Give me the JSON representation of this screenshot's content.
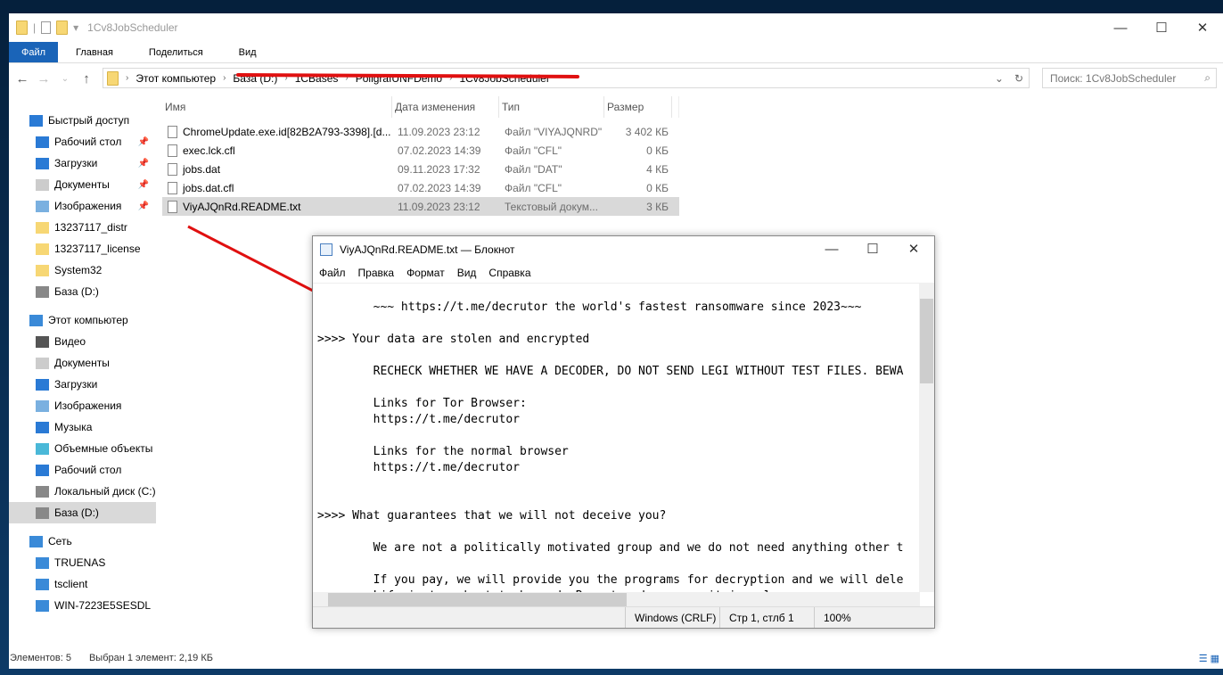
{
  "explorer": {
    "title": "1Cv8JobScheduler",
    "ribbon_tabs": [
      "Файл",
      "Главная",
      "Поделиться",
      "Вид"
    ],
    "breadcrumb": [
      "Этот компьютер",
      "База (D:)",
      "1CBases",
      "PoligrafUNFDemo",
      "1Cv8JobScheduler"
    ],
    "search_placeholder": "Поиск: 1Cv8JobScheduler",
    "columns": [
      "Имя",
      "Дата изменения",
      "Тип",
      "Размер"
    ],
    "files": [
      {
        "name": "ChromeUpdate.exe.id[82B2A793-3398].[d...",
        "date": "11.09.2023 23:12",
        "type": "Файл \"VIYAJQNRD\"",
        "size": "3 402 КБ"
      },
      {
        "name": "exec.lck.cfl",
        "date": "07.02.2023 14:39",
        "type": "Файл \"CFL\"",
        "size": "0 КБ"
      },
      {
        "name": "jobs.dat",
        "date": "09.11.2023 17:32",
        "type": "Файл \"DAT\"",
        "size": "4 КБ"
      },
      {
        "name": "jobs.dat.cfl",
        "date": "07.02.2023 14:39",
        "type": "Файл \"CFL\"",
        "size": "0 КБ"
      },
      {
        "name": "ViyAJQnRd.README.txt",
        "date": "11.09.2023 23:12",
        "type": "Текстовый докум...",
        "size": "3 КБ"
      }
    ],
    "sidebar": [
      {
        "label": "Быстрый доступ",
        "icon": "star-icon",
        "level": 0
      },
      {
        "label": "Рабочий стол",
        "icon": "desktop-icon",
        "level": 1,
        "pinned": true
      },
      {
        "label": "Загрузки",
        "icon": "download-icon",
        "level": 1,
        "pinned": true
      },
      {
        "label": "Документы",
        "icon": "documents-icon",
        "level": 1,
        "pinned": true
      },
      {
        "label": "Изображения",
        "icon": "pictures-icon",
        "level": 1,
        "pinned": true
      },
      {
        "label": "13237117_distr",
        "icon": "folder-icon",
        "level": 1
      },
      {
        "label": "13237117_license",
        "icon": "folder-icon",
        "level": 1
      },
      {
        "label": "System32",
        "icon": "folder-icon",
        "level": 1
      },
      {
        "label": "База (D:)",
        "icon": "drive-icon",
        "level": 1
      },
      {
        "label": "",
        "icon": "",
        "level": -1
      },
      {
        "label": "Этот компьютер",
        "icon": "computer-icon",
        "level": 0
      },
      {
        "label": "Видео",
        "icon": "video-icon",
        "level": 1
      },
      {
        "label": "Документы",
        "icon": "documents-icon",
        "level": 1
      },
      {
        "label": "Загрузки",
        "icon": "download-icon",
        "level": 1
      },
      {
        "label": "Изображения",
        "icon": "pictures-icon",
        "level": 1
      },
      {
        "label": "Музыка",
        "icon": "music-icon",
        "level": 1
      },
      {
        "label": "Объемные объекты",
        "icon": "3d-objects-icon",
        "level": 1
      },
      {
        "label": "Рабочий стол",
        "icon": "desktop-icon",
        "level": 1
      },
      {
        "label": "Локальный диск (C:)",
        "icon": "drive-icon",
        "level": 1
      },
      {
        "label": "База (D:)",
        "icon": "drive-icon",
        "level": 1,
        "selected": true
      },
      {
        "label": "",
        "icon": "",
        "level": -1
      },
      {
        "label": "Сеть",
        "icon": "network-icon",
        "level": 0
      },
      {
        "label": "TRUENAS",
        "icon": "computer-icon",
        "level": 1
      },
      {
        "label": "tsclient",
        "icon": "computer-icon",
        "level": 1
      },
      {
        "label": "WIN-7223E5SESDL",
        "icon": "computer-icon",
        "level": 1
      }
    ],
    "status_count": "Элементов: 5",
    "status_selected": "Выбран 1 элемент: 2,19 КБ"
  },
  "notepad": {
    "title": "ViyAJQnRd.README.txt — Блокнот",
    "menu": [
      "Файл",
      "Правка",
      "Формат",
      "Вид",
      "Справка"
    ],
    "content": "\n        ~~~ https://t.me/decrutor the world's fastest ransomware since 2023~~~\n\n>>>> Your data are stolen and encrypted\n\n        RECHECK WHETHER WE HAVE A DECODER, DO NOT SEND LEGI WITHOUT TEST FILES. BEWA\n\n        Links for Tor Browser:\n        https://t.me/decrutor\n\n        Links for the normal browser\n        https://t.me/decrutor\n\n\n>>>> What guarantees that we will not deceive you?\n\n        We are not a politically motivated group and we do not need anything other t\n\n        If you pay, we will provide you the programs for decryption and we will dele\n        Life is too short to be sad. Be not sad, money, it is only paper.",
    "status_encoding": "Windows (CRLF)",
    "status_position": "Стр 1, стлб 1",
    "status_zoom": "100%"
  }
}
